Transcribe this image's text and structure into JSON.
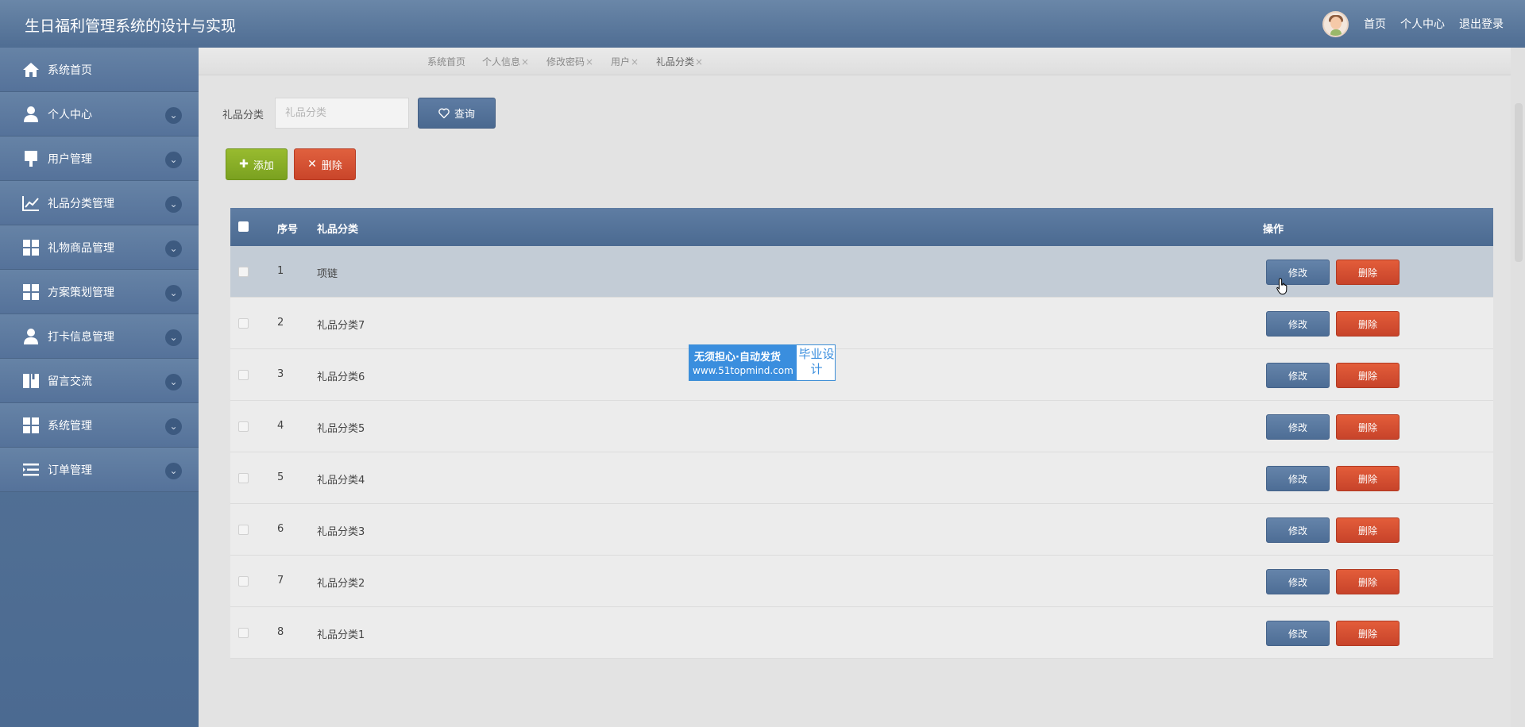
{
  "header": {
    "title": "生日福利管理系统的设计与实现",
    "links": [
      "首页",
      "个人中心",
      "退出登录"
    ]
  },
  "sidebar": {
    "items": [
      {
        "label": "系统首页",
        "icon": "home-icon",
        "expandable": false
      },
      {
        "label": "个人中心",
        "icon": "user-icon",
        "expandable": true
      },
      {
        "label": "用户管理",
        "icon": "brush-icon",
        "expandable": true
      },
      {
        "label": "礼品分类管理",
        "icon": "chart-icon",
        "expandable": true
      },
      {
        "label": "礼物商品管理",
        "icon": "grid-icon",
        "expandable": true
      },
      {
        "label": "方案策划管理",
        "icon": "grid-icon",
        "expandable": true
      },
      {
        "label": "打卡信息管理",
        "icon": "user-icon",
        "expandable": true
      },
      {
        "label": "留言交流",
        "icon": "book-icon",
        "expandable": true
      },
      {
        "label": "系统管理",
        "icon": "grid-icon",
        "expandable": true
      },
      {
        "label": "订单管理",
        "icon": "list-icon",
        "expandable": true
      }
    ]
  },
  "tabs": [
    {
      "label": "系统首页",
      "closable": false
    },
    {
      "label": "个人信息",
      "closable": true
    },
    {
      "label": "修改密码",
      "closable": true
    },
    {
      "label": "用户",
      "closable": true
    },
    {
      "label": "礼品分类",
      "closable": true
    }
  ],
  "tab_close": "×",
  "search": {
    "label": "礼品分类",
    "placeholder": "礼品分类",
    "value": "",
    "button": "查询"
  },
  "actions": {
    "add": "添加",
    "delete": "删除"
  },
  "table": {
    "headers": {
      "no": "序号",
      "name": "礼品分类",
      "op": "操作"
    },
    "rows": [
      {
        "no": "1",
        "name": "项链"
      },
      {
        "no": "2",
        "name": "礼品分类7"
      },
      {
        "no": "3",
        "name": "礼品分类6"
      },
      {
        "no": "4",
        "name": "礼品分类5"
      },
      {
        "no": "5",
        "name": "礼品分类4"
      },
      {
        "no": "6",
        "name": "礼品分类3"
      },
      {
        "no": "7",
        "name": "礼品分类2"
      },
      {
        "no": "8",
        "name": "礼品分类1"
      }
    ],
    "edit_label": "修改",
    "remove_label": "删除",
    "hover_row": 0
  },
  "watermark": {
    "line1": "无须担心·自动发货",
    "line2": "www.51topmind.com",
    "side": "毕业设计"
  },
  "colors": {
    "primary": "#4f6d93",
    "add": "#7aa120",
    "danger": "#c9452a"
  }
}
